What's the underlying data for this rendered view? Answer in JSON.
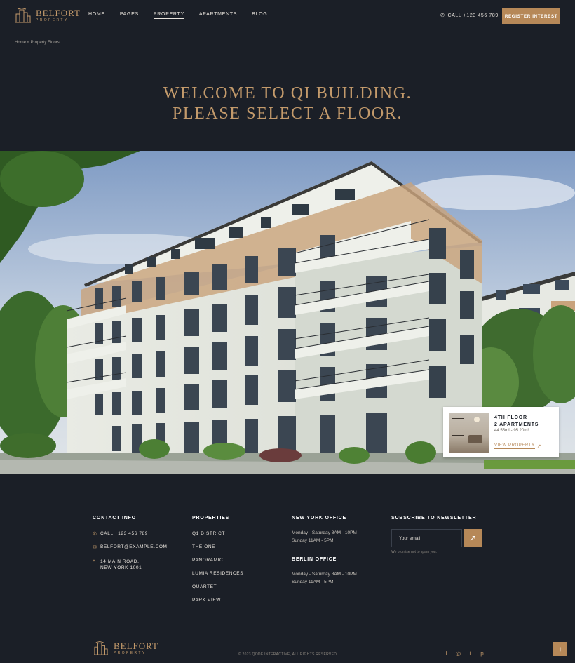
{
  "header": {
    "logo_name": "BELFORT",
    "logo_sub": "PROPERTY",
    "nav": [
      {
        "label": "HOME"
      },
      {
        "label": "PAGES"
      },
      {
        "label": "PROPERTY"
      },
      {
        "label": "APARTMENTS"
      },
      {
        "label": "BLOG"
      }
    ],
    "active_nav": "PROPERTY",
    "call": "CALL +123 456 789",
    "register": "REGISTER INTEREST"
  },
  "breadcrumb": "Home » Property Floors",
  "title_line1": "WELCOME TO QI BUILDING.",
  "title_line2": "PLEASE SELECT A FLOOR.",
  "floor_card": {
    "line1": "4TH FLOOR",
    "line2": "2 APARTMENTS",
    "area": "44.55m² - 95.20m²",
    "link": "VIEW PROPERTY"
  },
  "footer": {
    "contact": {
      "title": "CONTACT INFO",
      "phone": "CALL +123 456 789",
      "email": "BELFORT@EXAMPLE.COM",
      "address1": "14 MAIN ROAD,",
      "address2": "NEW YORK 1001"
    },
    "properties": {
      "title": "PROPERTIES",
      "items": [
        "Q1 DISTRICT",
        "THE ONE",
        "PANORAMIC",
        "LUMIA RESIDENCES",
        "QUARTET",
        "PARK VIEW"
      ]
    },
    "ny_office": {
      "title": "NEW YORK OFFICE",
      "line1": "Monday - Saturday 8AM - 10PM",
      "line2": "Sunday 11AM - 5PM"
    },
    "berlin_office": {
      "title": "BERLIN OFFICE",
      "line1": "Monday - Saturday 8AM - 10PM",
      "line2": "Sunday 11AM - 5PM"
    },
    "newsletter": {
      "title": "SUBSCRIBE TO NEWSLETTER",
      "placeholder": "Your email",
      "note": "We promise not to spam you."
    },
    "copyright": "© 2023 QODE INTERACTIVE, ALL RIGHTS RESERVED",
    "social": [
      "f",
      "◎",
      "t",
      "p"
    ]
  },
  "colors": {
    "accent": "#b68858",
    "background": "#1b1f27",
    "highlight_floor": "#c9a37c"
  }
}
